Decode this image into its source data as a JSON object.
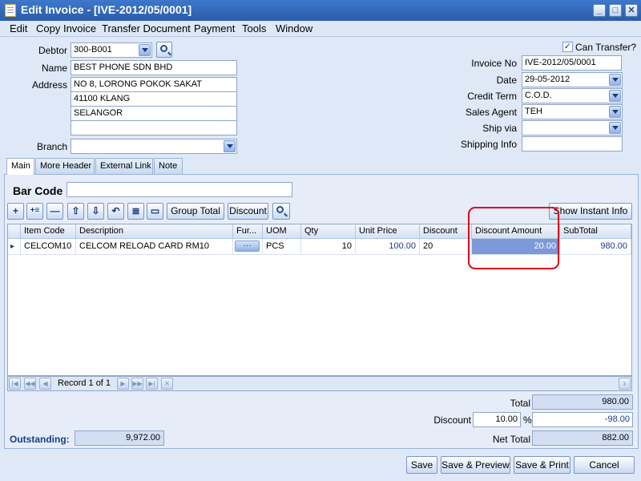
{
  "window": {
    "title": "Edit Invoice - [IVE-2012/05/0001]",
    "min_glyph": "_",
    "max_glyph": "□",
    "close_glyph": "✕"
  },
  "menu": [
    "Edit",
    "Copy Invoice",
    "Transfer Document",
    "Payment",
    "Tools",
    "Window"
  ],
  "header": {
    "debtor_label": "Debtor",
    "debtor_value": "300-B001",
    "name_label": "Name",
    "name_value": "BEST PHONE SDN BHD",
    "address_label": "Address",
    "address_lines": [
      "NO 8, LORONG POKOK SAKAT",
      "41100 KLANG",
      "SELANGOR",
      ""
    ],
    "branch_label": "Branch",
    "branch_value": "",
    "can_transfer_label": "Can Transfer?",
    "can_transfer_checked": true,
    "check_glyph": "✓",
    "invoice_no_label": "Invoice No",
    "invoice_no_value": "IVE-2012/05/0001",
    "date_label": "Date",
    "date_value": "29-05-2012",
    "credit_term_label": "Credit Term",
    "credit_term_value": "C.O.D.",
    "sales_agent_label": "Sales Agent",
    "sales_agent_value": "TEH",
    "ship_via_label": "Ship via",
    "ship_via_value": "",
    "shipping_info_label": "Shipping Info",
    "shipping_info_value": ""
  },
  "tabs": [
    "Main",
    "More Header",
    "External Link",
    "Note"
  ],
  "barcode": {
    "label": "Bar Code",
    "value": ""
  },
  "toolbar": {
    "add_glyph": "+",
    "insert_glyph": "+≡",
    "delete_glyph": "—",
    "move_up_glyph": "⇧",
    "move_down_glyph": "⇩",
    "undo_glyph": "↶",
    "subtotal_glyph": "≣",
    "detail_glyph": "▭",
    "group_total_label": "Group Total",
    "discount_label": "Discount",
    "show_instant_info_label": "Show Instant Info"
  },
  "grid": {
    "columns": [
      "Item Code",
      "Description",
      "Fur...",
      "UOM",
      "Qty",
      "Unit Price",
      "Discount",
      "Discount Amount",
      "SubTotal"
    ],
    "row_indicator": "▸",
    "ellipsis": "···",
    "rows": [
      {
        "item_code": "CELCOM10",
        "description": "CELCOM RELOAD CARD RM10",
        "uom": "PCS",
        "qty": "10",
        "unit_price": "100.00",
        "discount": "20",
        "discount_amount": "20.00",
        "subtotal": "980.00"
      }
    ]
  },
  "navigator": {
    "record_text": "Record 1 of 1",
    "first_glyph": "|◀",
    "prev_page_glyph": "◀◀",
    "prev_glyph": "◀",
    "next_glyph": "▶",
    "next_page_glyph": "▶▶",
    "last_glyph": "▶|",
    "cancel_glyph": "✕",
    "scroll_right_glyph": "›"
  },
  "totals": {
    "total_label": "Total",
    "total_value": "980.00",
    "discount_label": "Discount",
    "discount_percent": "10.00",
    "percent_sign": "%",
    "discount_value": "-98.00",
    "net_total_label": "Net Total",
    "net_total_value": "882.00",
    "outstanding_label": "Outstanding:",
    "outstanding_value": "9,972.00"
  },
  "buttons": {
    "save": "Save",
    "save_preview": "Save & Preview",
    "save_print": "Save & Print",
    "cancel": "Cancel"
  },
  "colors": {
    "highlight_border": "#e0001b",
    "selected_cell": "#7d99d9",
    "window_bg": "#dfe8f6"
  }
}
